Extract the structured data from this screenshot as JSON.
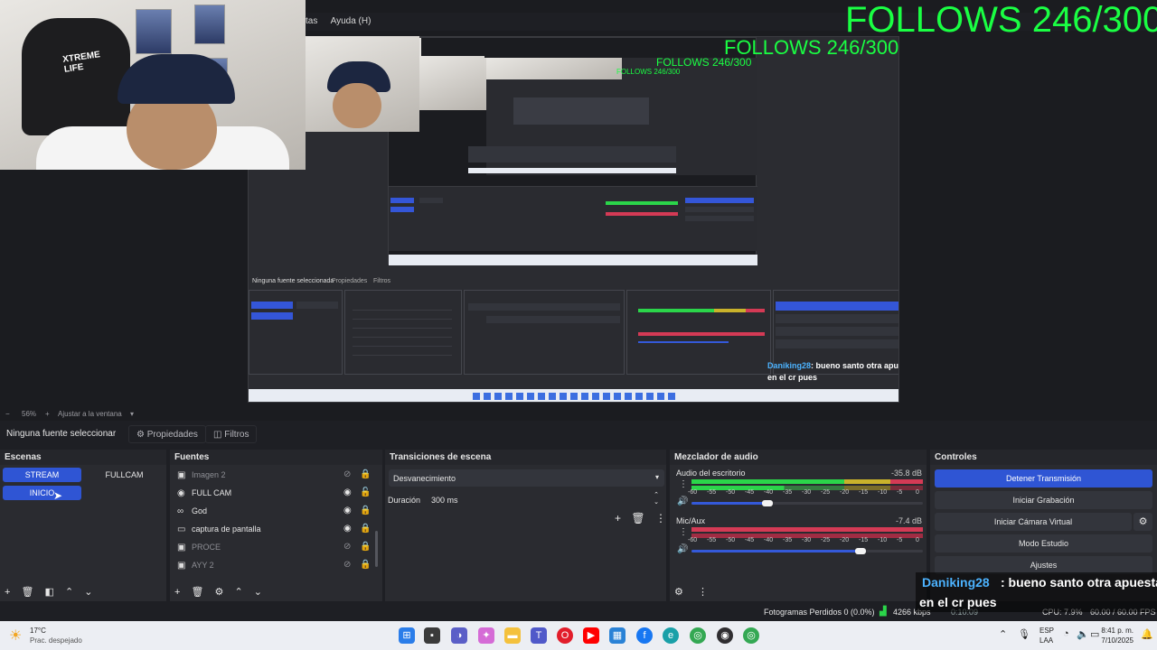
{
  "overlay": {
    "follows_text": "FOLLOWS 246/300"
  },
  "obs_menu": {
    "items": [
      "tas",
      "Ayuda (H)"
    ]
  },
  "preview": {
    "mini_menu": "Ayuda (H)",
    "mini_selection_label": "Ninguna fuente seleccionada",
    "mini_props": "Propiedades",
    "mini_filters": "Filtros",
    "mini_zoom": "56%",
    "mini_fit": "Ajustar a la ventana"
  },
  "zoom": {
    "percent": "56%",
    "fit_label": "Ajustar a la ventana"
  },
  "selection_row": {
    "label": "Ninguna fuente seleccionar",
    "properties": "Propiedades",
    "filters": "Filtros"
  },
  "scenes": {
    "title": "Escenas",
    "items": [
      {
        "label": "STREAM",
        "active": true
      },
      {
        "label": "FULLCAM",
        "active": false
      },
      {
        "label": "INICIO",
        "active": true
      }
    ]
  },
  "sources": {
    "title": "Fuentes",
    "items": [
      {
        "label": "Imagen 2",
        "icon": "image-icon",
        "visible": false,
        "locked": true
      },
      {
        "label": "FULL CAM",
        "icon": "camera-icon",
        "visible": true,
        "locked": false
      },
      {
        "label": "God",
        "icon": "gamepad-icon",
        "visible": true,
        "locked": true
      },
      {
        "label": "captura de pantalla",
        "icon": "monitor-icon",
        "visible": true,
        "locked": true
      },
      {
        "label": "PROCE",
        "icon": "image-icon",
        "visible": false,
        "locked": true
      },
      {
        "label": "AYY 2",
        "icon": "image-icon",
        "visible": false,
        "locked": true
      }
    ]
  },
  "transitions": {
    "title": "Transiciones de escena",
    "selected": "Desvanecimiento",
    "duration_label": "Duración",
    "duration_value": "300 ms"
  },
  "mixer": {
    "title": "Mezclador de audio",
    "channels": [
      {
        "name": "Audio del escritorio",
        "db": "-35.8 dB",
        "volume_fraction": 0.33
      },
      {
        "name": "Mic/Aux",
        "db": "-7.4 dB",
        "volume_fraction": 0.73
      }
    ],
    "ticks": [
      "-60",
      "-55",
      "-50",
      "-45",
      "-40",
      "-35",
      "-30",
      "-25",
      "-20",
      "-15",
      "-10",
      "-5",
      "0"
    ]
  },
  "controls": {
    "title": "Controles",
    "buttons": [
      {
        "label": "Detener Transmisión",
        "primary": true
      },
      {
        "label": "Iniciar Grabación",
        "primary": false
      },
      {
        "label": "Iniciar Cámara Virtual",
        "primary": false
      },
      {
        "label": "Modo Estudio",
        "primary": false
      },
      {
        "label": "Ajustes",
        "primary": false
      }
    ]
  },
  "stats": {
    "dropped_frames": "Fotogramas Perdidos 0 (0.0%)",
    "bitrate": "4266 kbps",
    "time": "0:10:09",
    "cpu": "CPU: 7.9%",
    "fps": "60.00 / 60.00 FPS"
  },
  "chat": {
    "username": "Daniking28",
    "message_line1": ": bueno santo otra apuesta",
    "message_line2": "en el cr pues"
  },
  "taskbar": {
    "weather_temp": "17°C",
    "weather_desc": "Prac. despejado",
    "lang": "ESP",
    "lang2": "LAA",
    "time": "8:41 p. m.",
    "date": "7/10/2025"
  },
  "colors": {
    "accent_blue": "#2f55d4",
    "follows_green": "#1aff43",
    "chat_name_blue": "#4cb3ff"
  }
}
